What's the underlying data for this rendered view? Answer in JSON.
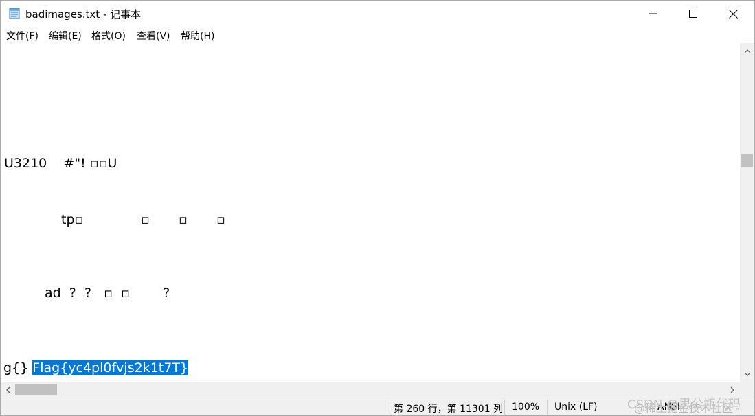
{
  "window": {
    "title": "badimages.txt - 记事本",
    "app_icon": "notepad-icon",
    "controls": {
      "minimize_icon": "minimize-icon",
      "maximize_icon": "maximize-icon",
      "close_icon": "close-icon"
    }
  },
  "menu": {
    "items": [
      "文件(F)",
      "编辑(E)",
      "格式(O)",
      "查看(V)",
      "帮助(H)"
    ]
  },
  "editor": {
    "lines": [
      {
        "text": "U3210    #\"! ▫▫U"
      },
      {
        "text": "tp▫"
      },
      {
        "text": "▫"
      },
      {
        "text": "▫"
      },
      {
        "text": "▫"
      },
      {
        "text": "ad  ?  ?   ▫  ▫        ?"
      },
      {
        "text": "g{} "
      }
    ],
    "selected_text": "Flag{yc4pl0fvjs2k1t7T}",
    "selection_color": "#0078d7"
  },
  "scrollbars": {
    "vertical_position_fraction": 0.35,
    "horizontal_position_fraction": 0.0
  },
  "status": {
    "position": "第 260 行，第 11301 列",
    "zoom": "100%",
    "line_ending": "Unix (LF)",
    "encoding": "ANSI"
  },
  "watermark": {
    "line1": "@稀土掘金技术社区",
    "line2": "CSDN @思公瓶代码"
  }
}
